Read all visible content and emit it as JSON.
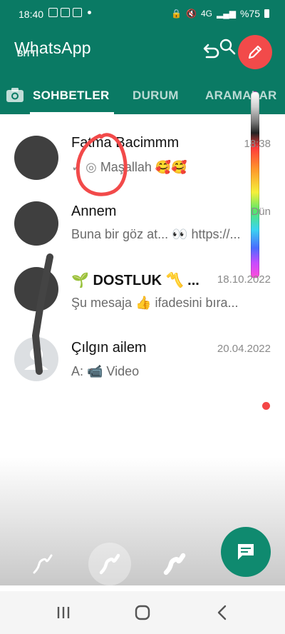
{
  "status_bar": {
    "time": "18:40",
    "network": "4G",
    "battery": "%75"
  },
  "app_bar": {
    "title": "WhatsApp",
    "overlay_label": "BITTI",
    "undo_icon": "undo-icon",
    "search_icon": "search-icon",
    "edit_icon": "pencil-icon"
  },
  "tabs": [
    {
      "label": "SOHBETLER",
      "active": true
    },
    {
      "label": "DURUM",
      "active": false
    },
    {
      "label": "ARAMALAR",
      "active": false
    }
  ],
  "chats": [
    {
      "name": "Fatma Bacimmm",
      "time": "18:38",
      "preview": "Maşallah 🥰🥰",
      "avatar": "scribbled"
    },
    {
      "name": "Annem",
      "time": "Dün",
      "preview": "Buna bir göz at... 👀 https://...",
      "avatar": "scribbled"
    },
    {
      "name": "🌱 DOSTLUK 〽️ ...",
      "time": "18.10.2022",
      "preview": "Şu mesaja 👍 ifadesini bıra...",
      "avatar": "scribbled"
    },
    {
      "name": "Çılgın ailem",
      "time": "20.04.2022",
      "preview": "A: 📹 Video",
      "avatar": "default"
    }
  ],
  "colors": {
    "header": "#0a7a64",
    "fab": "#0f8a6f",
    "edit_button": "#f24a4a",
    "annotation_red": "#f24a4a"
  }
}
